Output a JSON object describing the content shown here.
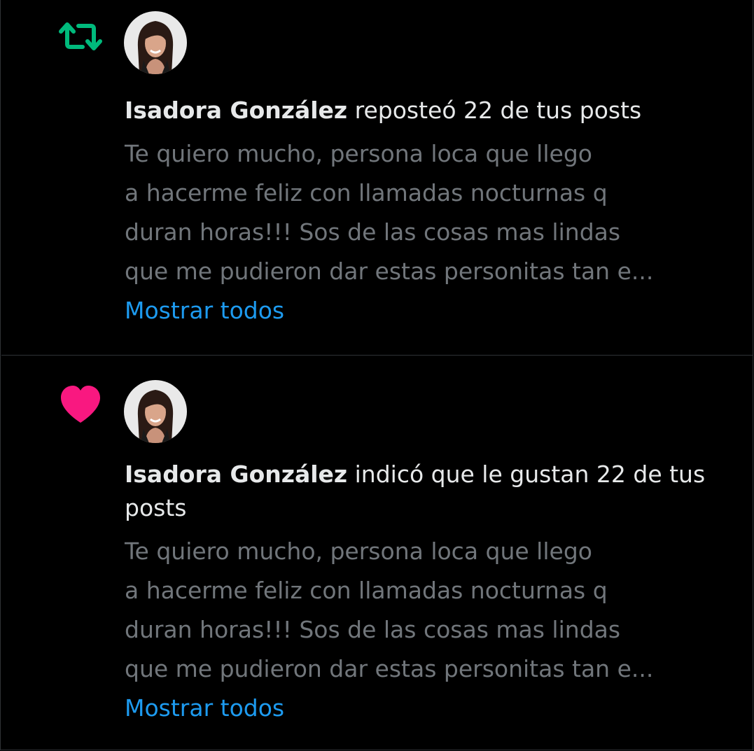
{
  "colors": {
    "background": "#000000",
    "text_primary": "#e7e9ea",
    "text_secondary": "#71767b",
    "link": "#1d9bf0",
    "repost_icon": "#00ba7c",
    "like_icon": "#f91880",
    "divider": "#2f3336"
  },
  "notifications": [
    {
      "type_icon": "repost-icon",
      "actor": "Isadora González",
      "action_text": " reposteó 22 de tus posts",
      "snippet": "Te quiero mucho, persona loca que llego\na hacerme feliz con llamadas nocturnas q\nduran horas!!! Sos de las cosas mas lindas\nque me pudieron dar estas personitas tan e...",
      "show_all_label": "Mostrar todos"
    },
    {
      "type_icon": "heart-icon",
      "actor": "Isadora González",
      "action_text": " indicó que le gustan 22 de tus posts",
      "snippet": "Te quiero mucho, persona loca que llego\na hacerme feliz con llamadas nocturnas q\nduran horas!!! Sos de las cosas mas lindas\nque me pudieron dar estas personitas tan e...",
      "show_all_label": "Mostrar todos"
    }
  ]
}
